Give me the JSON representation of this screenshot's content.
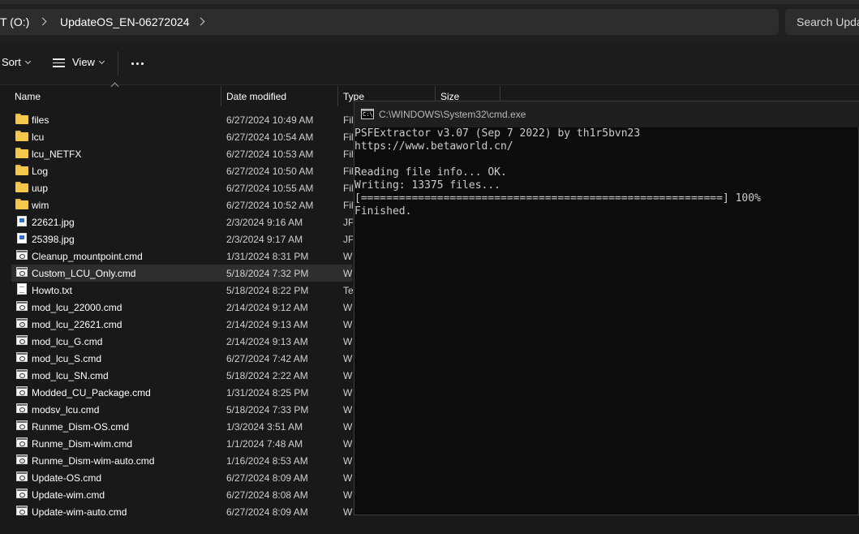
{
  "address_bar": {
    "crumbs": [
      "T (O:)",
      "UpdateOS_EN-06272024"
    ],
    "search_placeholder": "Search Upda"
  },
  "command_bar": {
    "sort_label": "Sort",
    "view_label": "View"
  },
  "columns": {
    "name": "Name",
    "date_modified": "Date modified",
    "type": "Type",
    "size": "Size"
  },
  "files": [
    {
      "name": "files",
      "date": "6/27/2024 10:49 AM",
      "type": "Fil",
      "icon": "folder-icon"
    },
    {
      "name": "lcu",
      "date": "6/27/2024 10:54 AM",
      "type": "Fil",
      "icon": "folder-icon"
    },
    {
      "name": "lcu_NETFX",
      "date": "6/27/2024 10:53 AM",
      "type": "Fil",
      "icon": "folder-icon"
    },
    {
      "name": "Log",
      "date": "6/27/2024 10:50 AM",
      "type": "Fil",
      "icon": "folder-icon"
    },
    {
      "name": "uup",
      "date": "6/27/2024 10:55 AM",
      "type": "Fil",
      "icon": "folder-icon"
    },
    {
      "name": "wim",
      "date": "6/27/2024 10:52 AM",
      "type": "Fil",
      "icon": "folder-icon"
    },
    {
      "name": "22621.jpg",
      "date": "2/3/2024 9:16 AM",
      "type": "JPG",
      "icon": "image-file-icon"
    },
    {
      "name": "25398.jpg",
      "date": "2/3/2024 9:17 AM",
      "type": "JPG",
      "icon": "image-file-icon"
    },
    {
      "name": "Cleanup_mountpoint.cmd",
      "date": "1/31/2024 8:31 PM",
      "type": "Wi",
      "icon": "script-file-icon"
    },
    {
      "name": "Custom_LCU_Only.cmd",
      "date": "5/18/2024 7:32 PM",
      "type": "Wi",
      "icon": "script-file-icon"
    },
    {
      "name": "Howto.txt",
      "date": "5/18/2024 8:22 PM",
      "type": "Tex",
      "icon": "text-file-icon"
    },
    {
      "name": "mod_lcu_22000.cmd",
      "date": "2/14/2024 9:12 AM",
      "type": "Wi",
      "icon": "script-file-icon"
    },
    {
      "name": "mod_lcu_22621.cmd",
      "date": "2/14/2024 9:13 AM",
      "type": "Wi",
      "icon": "script-file-icon"
    },
    {
      "name": "mod_lcu_G.cmd",
      "date": "2/14/2024 9:13 AM",
      "type": "Wi",
      "icon": "script-file-icon"
    },
    {
      "name": "mod_lcu_S.cmd",
      "date": "6/27/2024 7:42 AM",
      "type": "Wi",
      "icon": "script-file-icon"
    },
    {
      "name": "mod_lcu_SN.cmd",
      "date": "5/18/2024 2:22 AM",
      "type": "Wi",
      "icon": "script-file-icon"
    },
    {
      "name": "Modded_CU_Package.cmd",
      "date": "1/31/2024 8:25 PM",
      "type": "Wi",
      "icon": "script-file-icon"
    },
    {
      "name": "modsv_lcu.cmd",
      "date": "5/18/2024 7:33 PM",
      "type": "Wi",
      "icon": "script-file-icon"
    },
    {
      "name": "Runme_Dism-OS.cmd",
      "date": "1/3/2024 3:51 AM",
      "type": "Wi",
      "icon": "script-file-icon"
    },
    {
      "name": "Runme_Dism-wim.cmd",
      "date": "1/1/2024 7:48 AM",
      "type": "Wi",
      "icon": "script-file-icon"
    },
    {
      "name": "Runme_Dism-wim-auto.cmd",
      "date": "1/16/2024 8:53 AM",
      "type": "Wi",
      "icon": "script-file-icon"
    },
    {
      "name": "Update-OS.cmd",
      "date": "6/27/2024 8:09 AM",
      "type": "Wi",
      "icon": "script-file-icon"
    },
    {
      "name": "Update-wim.cmd",
      "date": "6/27/2024 8:08 AM",
      "type": "Wi",
      "icon": "script-file-icon"
    },
    {
      "name": "Update-wim-auto.cmd",
      "date": "6/27/2024 8:09 AM",
      "type": "Wi",
      "icon": "script-file-icon"
    }
  ],
  "selected_file": "Custom_LCU_Only.cmd",
  "console": {
    "title": "C:\\WINDOWS\\System32\\cmd.exe",
    "lines": [
      "PSFExtractor v3.07 (Sep 7 2022) by th1r5bvn23",
      "https://www.betaworld.cn/",
      "",
      "Reading file info... OK.",
      "Writing: 13375 files...",
      "[=========================================================] 100%",
      "Finished."
    ]
  },
  "colors": {
    "explorer_bg": "#191919",
    "console_bg": "#0c0c0c",
    "console_text": "#cccccc",
    "folder": "#f5c84c",
    "selection": "#2e2e2e"
  }
}
